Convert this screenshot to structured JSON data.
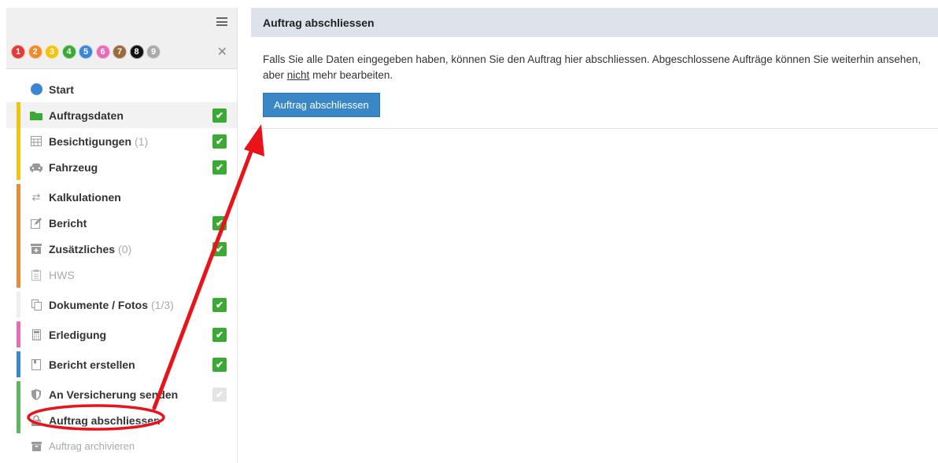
{
  "sidebar": {
    "steps": [
      {
        "n": "1",
        "color": "#e03a3a"
      },
      {
        "n": "2",
        "color": "#f08a2a"
      },
      {
        "n": "3",
        "color": "#f3c30f"
      },
      {
        "n": "4",
        "color": "#3aaa35"
      },
      {
        "n": "5",
        "color": "#3a86d4"
      },
      {
        "n": "6",
        "color": "#e96bb8"
      },
      {
        "n": "7",
        "color": "#9b6a3c"
      },
      {
        "n": "8",
        "color": "#111111"
      },
      {
        "n": "9",
        "color": "#aaaaaa"
      }
    ],
    "close": "✕",
    "items": [
      {
        "label": "Start",
        "count": "",
        "icon": "blue-dot"
      },
      {
        "label": "Auftragsdaten",
        "count": "",
        "icon": "folder-icon"
      },
      {
        "label": "Besichtigungen",
        "count": "(1)",
        "icon": "calendar-icon"
      },
      {
        "label": "Fahrzeug",
        "count": "",
        "icon": "car-icon"
      },
      {
        "label": "Kalkulationen",
        "count": "",
        "icon": "exchange-icon"
      },
      {
        "label": "Bericht",
        "count": "",
        "icon": "edit-icon"
      },
      {
        "label": "Zusätzliches",
        "count": "(0)",
        "icon": "plus-box-icon"
      },
      {
        "label": "HWS",
        "count": "",
        "icon": "clipboard-icon"
      },
      {
        "label": "Dokumente / Fotos",
        "count": "(1/3)",
        "icon": "copy-icon"
      },
      {
        "label": "Erledigung",
        "count": "",
        "icon": "calculator-icon"
      },
      {
        "label": "Bericht erstellen",
        "count": "",
        "icon": "book-icon"
      },
      {
        "label": "An Versicherung senden",
        "count": "",
        "icon": "shield-icon"
      },
      {
        "label": "Auftrag abschliessen",
        "count": "",
        "icon": "lock-icon"
      },
      {
        "label": "Auftrag archivieren",
        "count": "",
        "icon": "archive-icon"
      }
    ],
    "colors": {
      "yellow": "#f3c30f",
      "orange": "#ec8a3a",
      "pink": "#e96bb8",
      "blue": "#3a86d4",
      "green": "#5cb85c"
    }
  },
  "panel": {
    "title": "Auftrag abschliessen",
    "text_part1": "Falls Sie alle Daten eingegeben haben, können Sie den Auftrag hier abschliessen. Abgeschlossene Aufträge können Sie weiterhin ansehen, aber ",
    "text_underlined": "nicht",
    "text_part2": " mehr bearbeiten.",
    "button_label": "Auftrag abschliessen"
  }
}
